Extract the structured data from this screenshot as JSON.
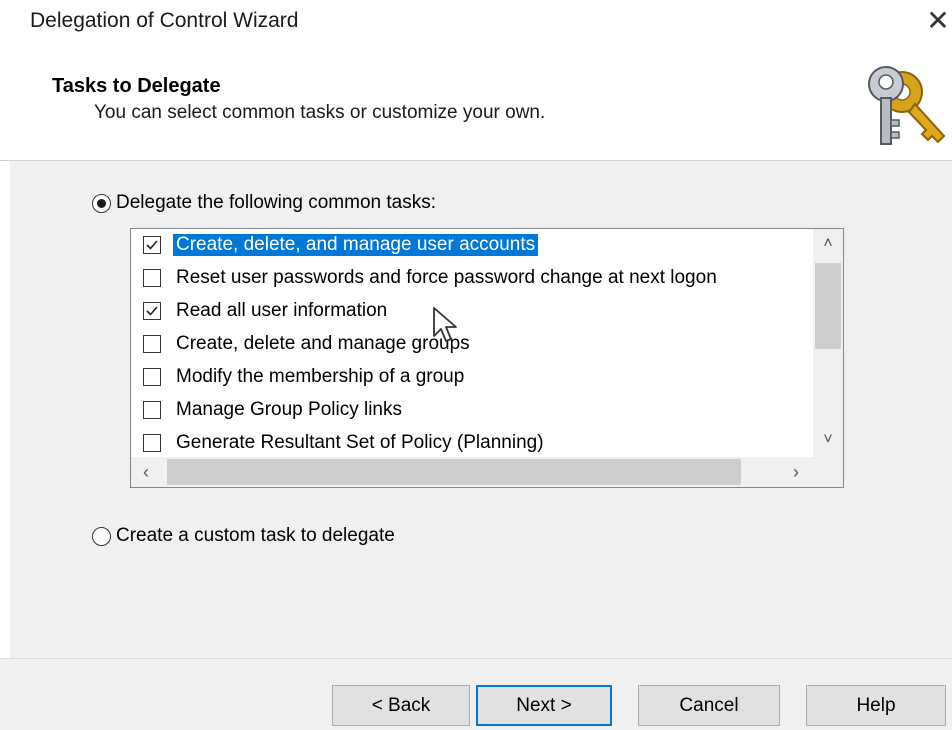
{
  "window": {
    "title": "Delegation of Control Wizard",
    "close_glyph": "✕"
  },
  "header": {
    "title": "Tasks to Delegate",
    "subtitle": "You can select common tasks or customize your own.",
    "icon": "keys-icon"
  },
  "options": {
    "common": {
      "label": "Delegate the following common tasks:",
      "selected": true
    },
    "custom": {
      "label": "Create a custom task to delegate",
      "selected": false
    }
  },
  "tasks": [
    {
      "label": "Create, delete, and manage user accounts",
      "checked": true,
      "highlighted": true
    },
    {
      "label": "Reset user passwords and force password change at next logon",
      "checked": false,
      "highlighted": false
    },
    {
      "label": "Read all user information",
      "checked": true,
      "highlighted": false
    },
    {
      "label": "Create, delete and manage groups",
      "checked": false,
      "highlighted": false
    },
    {
      "label": "Modify the membership of a group",
      "checked": false,
      "highlighted": false
    },
    {
      "label": "Manage Group Policy links",
      "checked": false,
      "highlighted": false
    },
    {
      "label": "Generate Resultant Set of Policy (Planning)",
      "checked": false,
      "highlighted": false
    }
  ],
  "scrollbar_glyphs": {
    "up": "˄",
    "down": "˅",
    "left": "‹",
    "right": "›"
  },
  "buttons": {
    "back": "< Back",
    "next": "Next >",
    "cancel": "Cancel",
    "help": "Help"
  },
  "colors": {
    "selection": "#0078d7",
    "content_bg": "#f0f0f0",
    "default_button_border": "#0078d7"
  }
}
